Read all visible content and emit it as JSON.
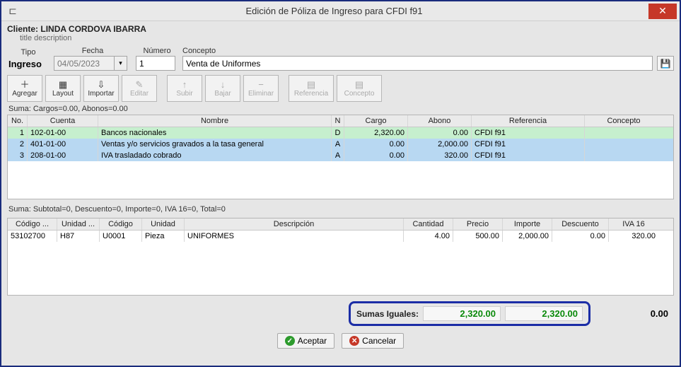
{
  "window_title": "Edición de Póliza de Ingreso para CFDI f91",
  "client": {
    "label": "Cliente:",
    "name": "LINDA CORDOVA IBARRA",
    "subtitle": "title description"
  },
  "form": {
    "tipo_label": "Tipo",
    "tipo_value": "Ingreso",
    "fecha_label": "Fecha",
    "fecha_value": "04/05/2023",
    "numero_label": "Número",
    "numero_value": "1",
    "concepto_label": "Concepto",
    "concepto_value": "Venta de Uniformes"
  },
  "toolbar": {
    "agregar": "Agregar",
    "layout": "Layout",
    "importar": "Importar",
    "editar": "Editar",
    "subir": "Subir",
    "bajar": "Bajar",
    "eliminar": "Eliminar",
    "referencia": "Referencia",
    "concepto": "Concepto"
  },
  "grid1": {
    "summary": "Suma:  Cargos=0.00, Abonos=0.00",
    "headers": {
      "no": "No.",
      "cuenta": "Cuenta",
      "nombre": "Nombre",
      "n": "N",
      "cargo": "Cargo",
      "abono": "Abono",
      "referencia": "Referencia",
      "concepto": "Concepto"
    },
    "rows": [
      {
        "no": "1",
        "cuenta": "102-01-00",
        "nombre": "Bancos nacionales",
        "n": "D",
        "cargo": "2,320.00",
        "abono": "0.00",
        "ref": "CFDI f91",
        "conc": ""
      },
      {
        "no": "2",
        "cuenta": "401-01-00",
        "nombre": "Ventas y/o servicios gravados a la tasa general",
        "n": "A",
        "cargo": "0.00",
        "abono": "2,000.00",
        "ref": "CFDI f91",
        "conc": ""
      },
      {
        "no": "3",
        "cuenta": "208-01-00",
        "nombre": "IVA trasladado cobrado",
        "n": "A",
        "cargo": "0.00",
        "abono": "320.00",
        "ref": "CFDI f91",
        "conc": ""
      }
    ]
  },
  "grid2": {
    "summary": "Suma:  Subtotal=0, Descuento=0, Importe=0, IVA 16=0, Total=0",
    "headers": {
      "codigo": "Código ...",
      "unidad_c": "Unidad ...",
      "codigo_u": "Código",
      "unidad": "Unidad",
      "descripcion": "Descripción",
      "cantidad": "Cantidad",
      "precio": "Precio",
      "importe": "Importe",
      "descuento": "Descuento",
      "iva": "IVA 16"
    },
    "rows": [
      {
        "codigo": "53102700",
        "unidad_c": "H87",
        "codigo_u": "U0001",
        "unidad": "Pieza",
        "descripcion": "UNIFORMES",
        "cantidad": "4.00",
        "precio": "500.00",
        "importe": "2,000.00",
        "descuento": "0.00",
        "iva": "320.00"
      }
    ]
  },
  "totals": {
    "label": "Sumas Iguales:",
    "cargo": "2,320.00",
    "abono": "2,320.00",
    "outside": "0.00"
  },
  "buttons": {
    "accept": "Aceptar",
    "cancel": "Cancelar"
  }
}
